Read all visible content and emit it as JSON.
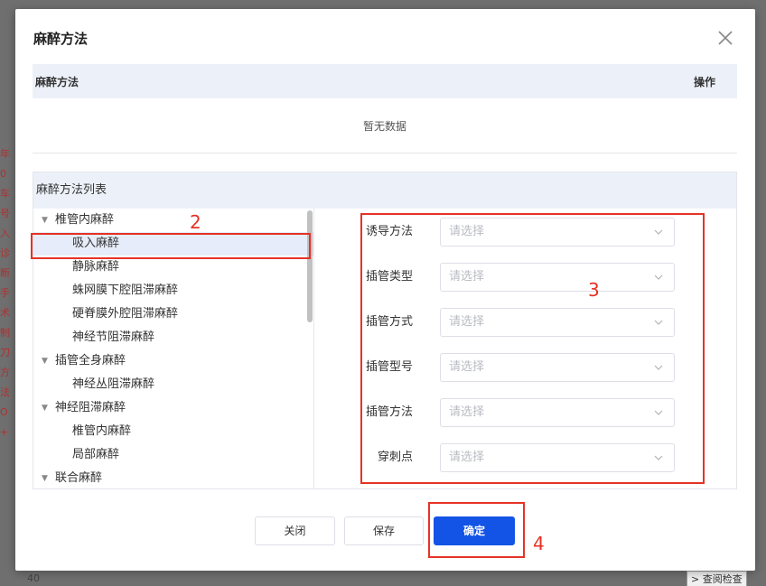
{
  "background": {
    "left_strip": [
      "年0",
      "车号",
      "入",
      "诊断",
      "手术",
      "制刀",
      "方法",
      "O +"
    ],
    "bottom_left": "40",
    "bottom_right": "> 查阅检查"
  },
  "dialog": {
    "title": "麻醉方法",
    "close_icon": "close-icon",
    "table": {
      "col_method": "麻醉方法",
      "col_action": "操作",
      "empty_text": "暂无数据"
    },
    "list_title": "麻醉方法列表",
    "tree": [
      {
        "label": "椎管内麻醉",
        "level": 0,
        "expanded": true
      },
      {
        "label": "吸入麻醉",
        "level": 1,
        "selected": true
      },
      {
        "label": "静脉麻醉",
        "level": 1
      },
      {
        "label": "蛛网膜下腔阻滞麻醉",
        "level": 1
      },
      {
        "label": "硬脊膜外腔阻滞麻醉",
        "level": 1
      },
      {
        "label": "神经节阻滞麻醉",
        "level": 1
      },
      {
        "label": "插管全身麻醉",
        "level": 0,
        "expanded": true
      },
      {
        "label": "神经丛阻滞麻醉",
        "level": 1
      },
      {
        "label": "神经阻滞麻醉",
        "level": 0,
        "expanded": true
      },
      {
        "label": "椎管内麻醉",
        "level": 1
      },
      {
        "label": "局部麻醉",
        "level": 1
      },
      {
        "label": "联合麻醉",
        "level": 0,
        "expanded": true
      }
    ],
    "form": [
      {
        "label": "诱导方法",
        "placeholder": "请选择"
      },
      {
        "label": "插管类型",
        "placeholder": "请选择"
      },
      {
        "label": "插管方式",
        "placeholder": "请选择"
      },
      {
        "label": "插管型号",
        "placeholder": "请选择"
      },
      {
        "label": "插管方法",
        "placeholder": "请选择"
      },
      {
        "label": "穿刺点",
        "placeholder": "请选择"
      }
    ],
    "buttons": {
      "close": "关闭",
      "save": "保存",
      "confirm": "确定"
    }
  },
  "annotations": [
    "2",
    "3",
    "4"
  ],
  "colors": {
    "primary": "#1354e6",
    "annotation": "#e53326",
    "header_bg": "#ecf1f9",
    "selected_bg": "#e6ecf9"
  }
}
